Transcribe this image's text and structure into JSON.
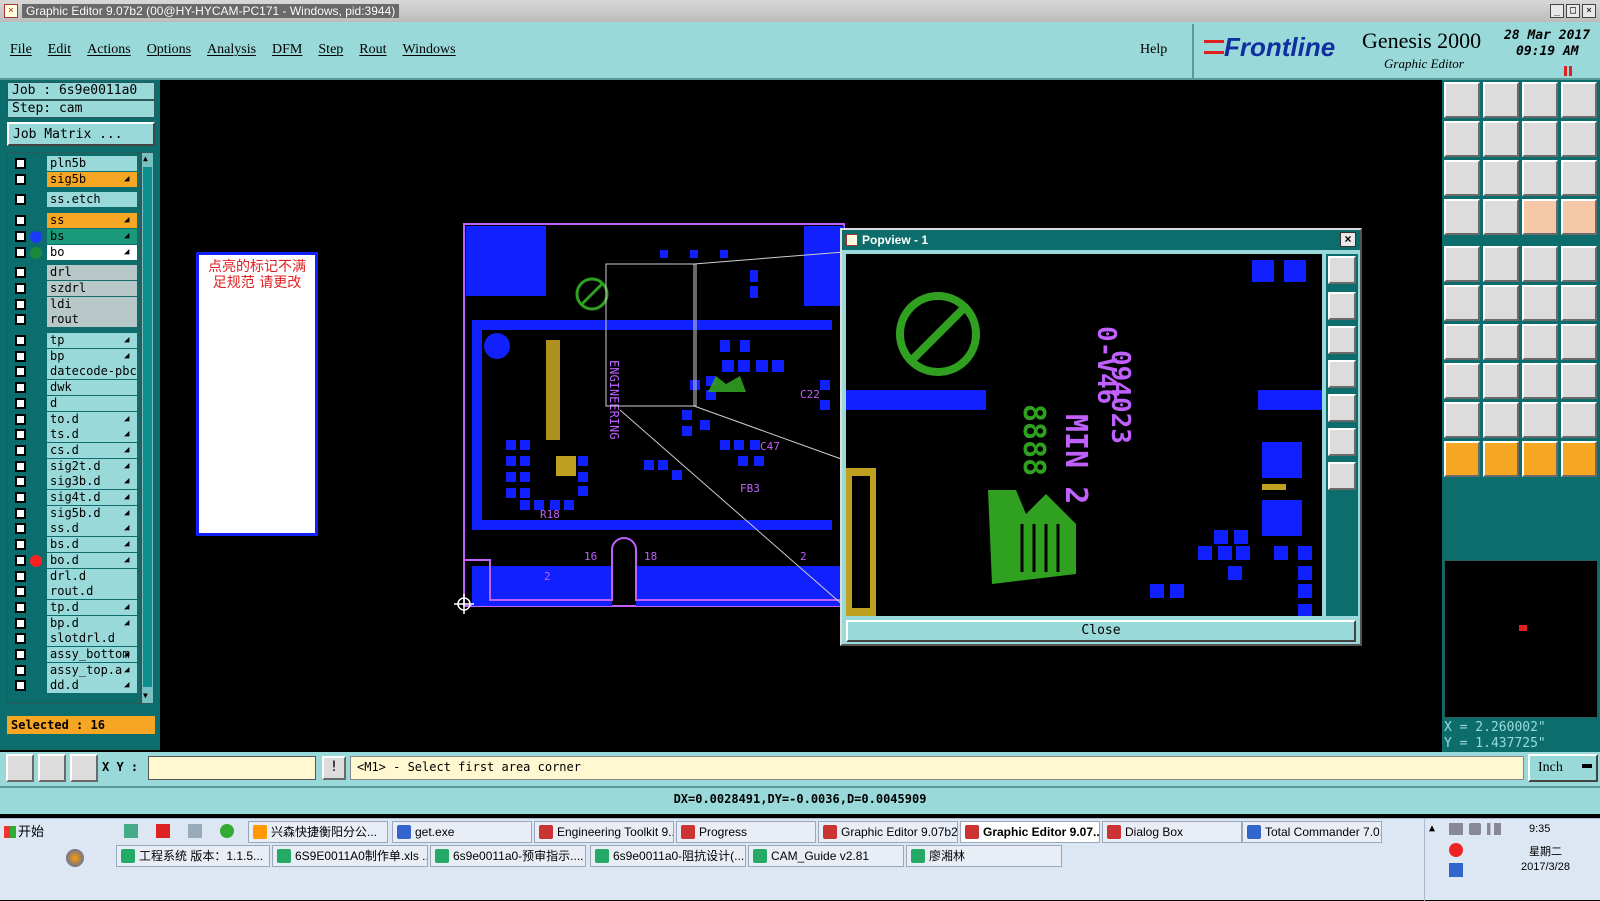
{
  "window": {
    "title": "Graphic Editor 9.07b2 (00@HY-HYCAM-PC171 - Windows, pid:3944)"
  },
  "menu": {
    "items": [
      "File",
      "Edit",
      "Actions",
      "Options",
      "Analysis",
      "DFM",
      "Step",
      "Rout",
      "Windows"
    ],
    "help": "Help"
  },
  "brand": {
    "logo": "Frontline",
    "product": "Genesis 2000",
    "subtitle": "Graphic Editor",
    "date": "28 Mar 2017",
    "time": "09:19 AM"
  },
  "job": {
    "job_label": "Job : 6s9e0011a0",
    "step_label": "Step: cam",
    "matrix_button": "Job Matrix ..."
  },
  "layers": [
    {
      "name": "pln5b",
      "color": "#9ad9d9",
      "gap": 0
    },
    {
      "name": "sig5b",
      "color": "#f5a623",
      "lock": true
    },
    {
      "name": "ss.etch",
      "color": "#9ad9d9",
      "gap": 1
    },
    {
      "name": "ss",
      "color": "#f5a623",
      "lock": true,
      "gap": 1
    },
    {
      "name": "bs",
      "color": "#1a9a7a",
      "lock": true,
      "dot": "#1a3aff"
    },
    {
      "name": "bo",
      "color": "#ffffff",
      "lock": true,
      "dot": "#1a8a3a"
    },
    {
      "name": "drl",
      "color": "#b8c8c8",
      "gap": 1
    },
    {
      "name": "szdrl",
      "color": "#b8c8c8"
    },
    {
      "name": "ldi",
      "color": "#b8c8c8"
    },
    {
      "name": "rout",
      "color": "#b8c8c8"
    },
    {
      "name": "tp",
      "color": "#9ad9d9",
      "lock": true,
      "gap": 1
    },
    {
      "name": "bp",
      "color": "#9ad9d9",
      "lock": true
    },
    {
      "name": "datecode-pbc",
      "color": "#9ad9d9"
    },
    {
      "name": "dwk",
      "color": "#9ad9d9"
    },
    {
      "name": "d",
      "color": "#9ad9d9"
    },
    {
      "name": "to.d",
      "color": "#9ad9d9",
      "lock": true
    },
    {
      "name": "ts.d",
      "color": "#9ad9d9",
      "lock": true
    },
    {
      "name": "cs.d",
      "color": "#9ad9d9",
      "lock": true
    },
    {
      "name": "sig2t.d",
      "color": "#9ad9d9",
      "lock": true
    },
    {
      "name": "sig3b.d",
      "color": "#9ad9d9",
      "lock": true
    },
    {
      "name": "sig4t.d",
      "color": "#9ad9d9",
      "lock": true
    },
    {
      "name": "sig5b.d",
      "color": "#9ad9d9",
      "lock": true
    },
    {
      "name": "ss.d",
      "color": "#9ad9d9",
      "lock": true
    },
    {
      "name": "bs.d",
      "color": "#9ad9d9",
      "lock": true
    },
    {
      "name": "bo.d",
      "color": "#9ad9d9",
      "lock": true,
      "dot": "#ff2020"
    },
    {
      "name": "drl.d",
      "color": "#9ad9d9"
    },
    {
      "name": "rout.d",
      "color": "#9ad9d9"
    },
    {
      "name": "tp.d",
      "color": "#9ad9d9",
      "lock": true
    },
    {
      "name": "bp.d",
      "color": "#9ad9d9",
      "lock": true
    },
    {
      "name": "slotdrl.d",
      "color": "#9ad9d9"
    },
    {
      "name": "assy_bottom",
      "color": "#9ad9d9",
      "lock": true
    },
    {
      "name": "assy_top.a",
      "color": "#9ad9d9",
      "lock": true
    },
    {
      "name": "dd.d",
      "color": "#9ad9d9",
      "lock": true
    }
  ],
  "selected": "Selected : 16",
  "note": {
    "text": "点亮的标记不满足规范 请更改"
  },
  "popview": {
    "title": "Popview - 1",
    "close_label": "Close"
  },
  "coords": {
    "x": "X = 2.260002\"",
    "y": "Y = 1.437725\""
  },
  "command": {
    "xy_label": "X Y :",
    "xy_value": "",
    "prompt": "<M1> - Select first area corner",
    "units": "Inch"
  },
  "status": {
    "text": "DX=0.0028491,DY=-0.0036,D=0.0045909"
  },
  "taskbar": {
    "start": "开始",
    "row1": [
      "兴森快捷衡阳分公...",
      "get.exe",
      "Engineering Toolkit 9....",
      "Progress",
      "Graphic Editor 9.07b2...",
      "Graphic Editor 9.07...",
      "Dialog Box",
      "Total Commander 7.0..."
    ],
    "row2": [
      "工程系统  版本：1.1.5...",
      "6S9E0011A0制作单.xls ...",
      "6s9e0011a0-预审指示....",
      "6s9e0011a0-阻抗设计(...",
      "CAM_Guide v2.81",
      "廖湘林"
    ],
    "clock": "9:35",
    "weekday": "星期二",
    "date": "2017/3/28"
  },
  "colors": {
    "teal": "#9ad9d9",
    "dark_teal": "#0d6d6d",
    "copper": "#1020ff",
    "silk": "#c060ff",
    "gold": "#c0a020",
    "green": "#30a020"
  }
}
